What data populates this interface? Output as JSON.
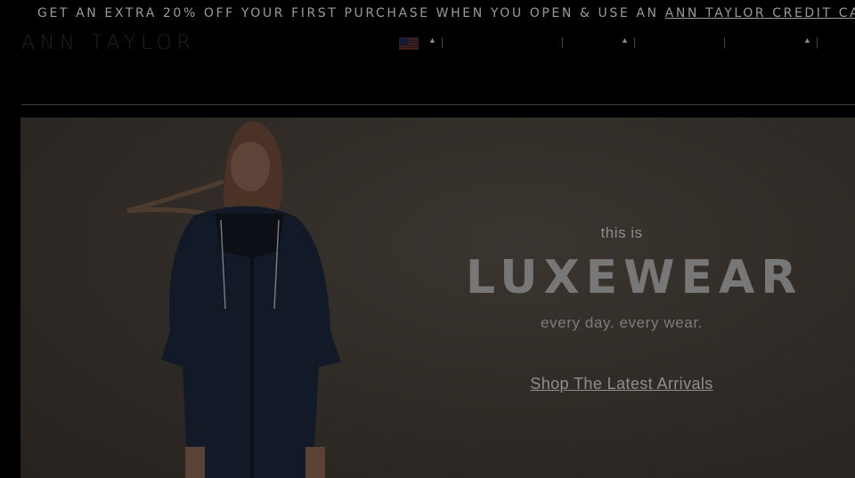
{
  "promo": {
    "text": "GET AN EXTRA 20% OFF YOUR FIRST PURCHASE WHEN YOU OPEN & USE AN",
    "link": "ANN TAYLOR CREDIT CARD"
  },
  "brand": {
    "logo": "ANN TAYLOR"
  },
  "utility": {
    "flag_icon": "us-flag-icon"
  },
  "hero": {
    "eyebrow": "this is",
    "headline": "LUXEWEAR",
    "tagline": "every day. every wear.",
    "cta": "Shop The Latest Arrivals"
  }
}
